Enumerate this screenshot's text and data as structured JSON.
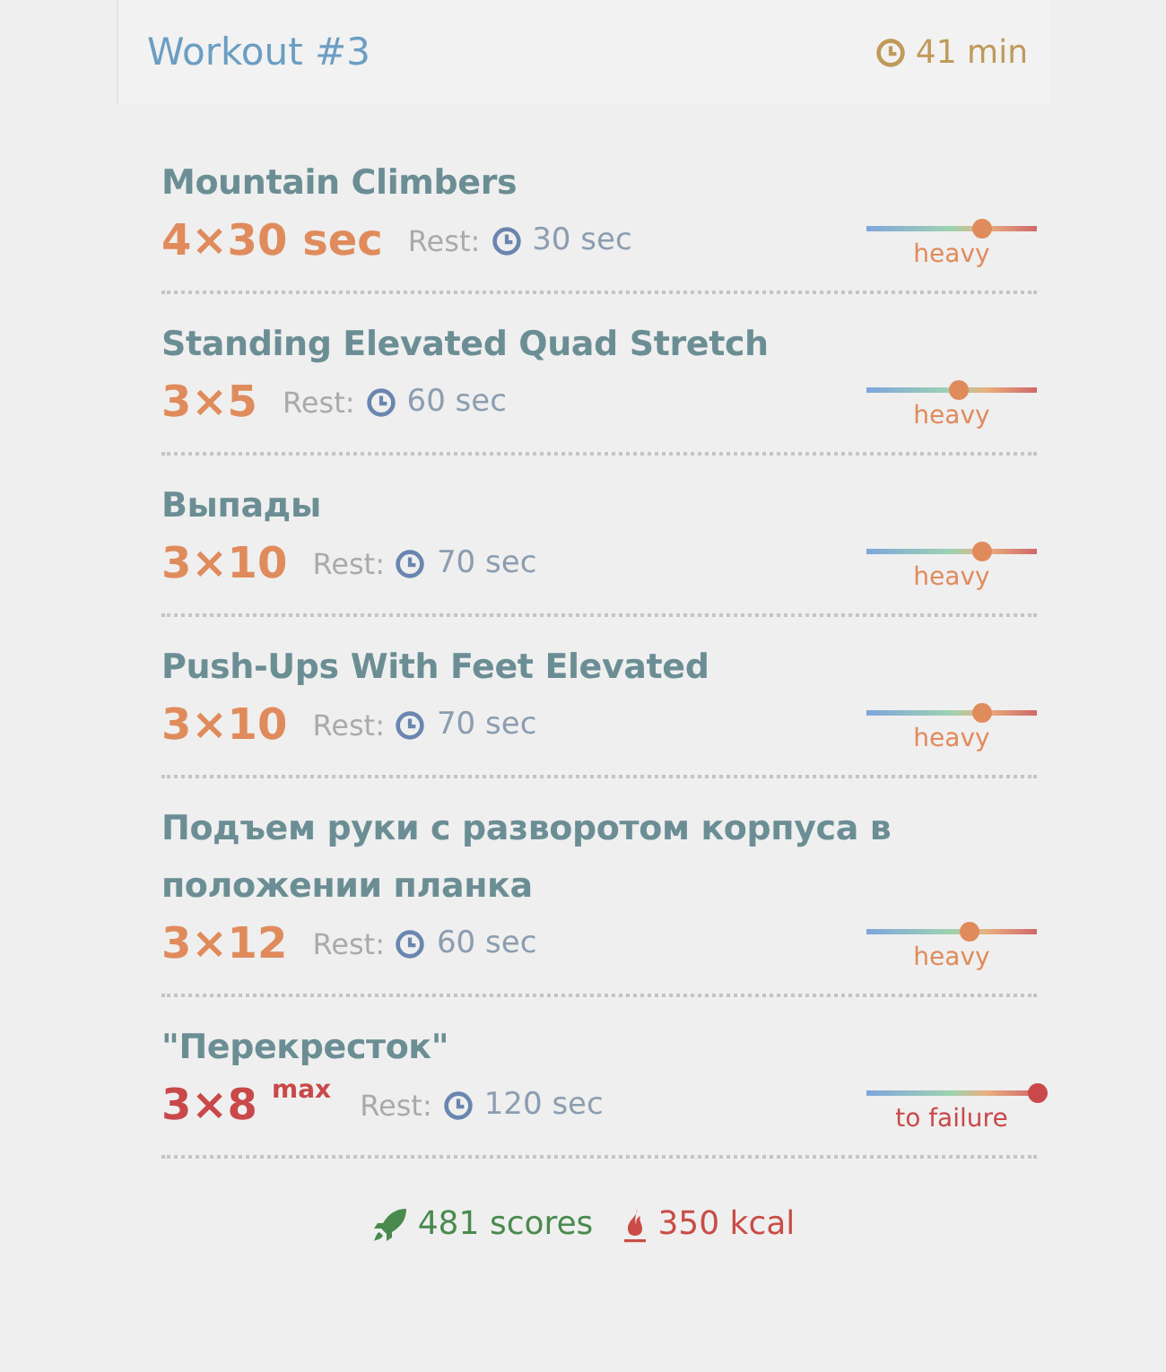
{
  "header": {
    "title": "Workout #3",
    "duration": "41 min"
  },
  "exercises": [
    {
      "name": "Mountain Climbers",
      "sets": "4×30 sec",
      "rest_label": "Rest:",
      "rest": "30 sec",
      "kind": "heavy",
      "intensity": "heavy",
      "level": 0.67
    },
    {
      "name": "Standing Elevated Quad Stretch",
      "sets": "3×5",
      "rest_label": "Rest:",
      "rest": "60 sec",
      "kind": "heavy",
      "intensity": "heavy",
      "level": 0.54
    },
    {
      "name": "Выпады",
      "sets": "3×10",
      "rest_label": "Rest:",
      "rest": "70 sec",
      "kind": "heavy",
      "intensity": "heavy",
      "level": 0.67
    },
    {
      "name": "Push-Ups With Feet Elevated",
      "sets": "3×10",
      "rest_label": "Rest:",
      "rest": "70 sec",
      "kind": "heavy",
      "intensity": "heavy",
      "level": 0.67
    },
    {
      "name": "Подъем руки с разворотом корпуса в положении планка",
      "sets": "3×12",
      "rest_label": "Rest:",
      "rest": "60 sec",
      "kind": "heavy",
      "intensity": "heavy",
      "level": 0.6
    },
    {
      "name": "\"Перекресток\"",
      "sets": "3×8",
      "sets_note": "max",
      "rest_label": "Rest:",
      "rest": "120 sec",
      "kind": "failure",
      "intensity": "to failure",
      "level": 1.0
    }
  ],
  "footer": {
    "scores": "481 scores",
    "calories": "350 kcal"
  }
}
